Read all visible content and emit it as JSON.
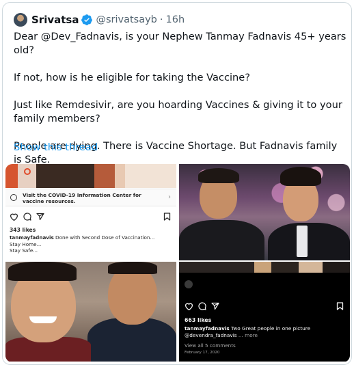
{
  "tweet": {
    "author_name": "Srivatsa",
    "handle": "@srivatsayb",
    "separator": "·",
    "time": "16h",
    "paragraphs": [
      "Dear @Dev_Fadnavis, is your Nephew Tanmay Fadnavis 45+ years old?",
      "If not, how is he eligible for taking the Vaccine?",
      "Just like Remdesivir, are you hoarding Vaccines & giving it to your family members?",
      "People are dying. There is Vaccine Shortage. But Fadnavis family is Safe."
    ],
    "show_thread": "Show this thread",
    "verified_color": "#1d9bf0",
    "link_color": "#1d9bf0"
  },
  "media": {
    "post1": {
      "covid_banner": "Visit the COVID-19 Information Center for vaccine resources.",
      "chevron": "›",
      "likes": "343 likes",
      "username": "tanmayfadnavis",
      "caption": "Done with Second Dose of Vaccination...",
      "caption_line2": "Stay Home...",
      "caption_line3": "Stay Safe..."
    },
    "post2": {
      "likes": "663 likes",
      "username": "tanmayfadnavis",
      "caption": "Two Great people in one picture",
      "mention": "@devendra_fadnavis",
      "more": "... more",
      "comments": "View all 5 comments",
      "date": "February 17, 2020"
    }
  },
  "icons": [
    "verified-badge-icon",
    "heart-icon",
    "comment-icon",
    "share-icon",
    "bookmark-icon",
    "info-icon",
    "chevron-right-icon"
  ]
}
